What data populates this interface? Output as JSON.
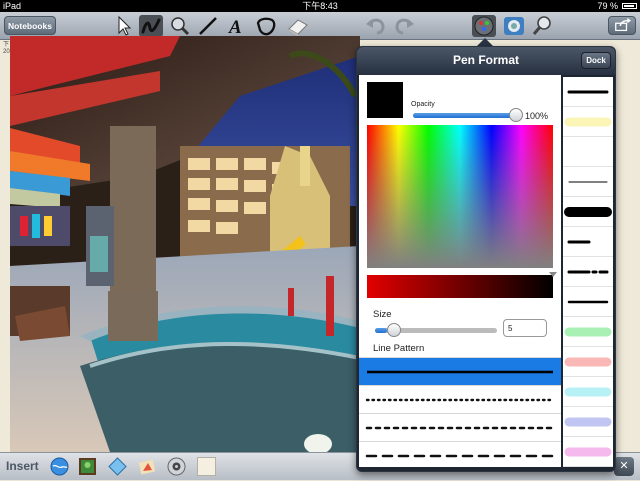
{
  "status": {
    "device": "iPad",
    "time": "下午8:43",
    "battery": "79 %"
  },
  "toolbar": {
    "notebooks_label": "Notebooks",
    "tools": [
      {
        "name": "select-tool-icon"
      },
      {
        "name": "pen-tool-icon"
      },
      {
        "name": "highlighter-tool-icon"
      },
      {
        "name": "line-tool-icon"
      },
      {
        "name": "text-tool-icon"
      },
      {
        "name": "shape-tool-icon"
      },
      {
        "name": "eraser-tool-icon"
      },
      {
        "name": "undo-icon"
      },
      {
        "name": "redo-icon"
      },
      {
        "name": "pen-format-icon"
      },
      {
        "name": "highlighter-format-icon"
      },
      {
        "name": "magnifier-icon"
      }
    ]
  },
  "page": {
    "margin_text": "下\n20"
  },
  "pen_format": {
    "title": "Pen Format",
    "dock_label": "Dock",
    "opacity_label": "Opacity",
    "opacity_value": "100%",
    "opacity_level": 1.0,
    "size_label": "Size",
    "size_value": "5",
    "size_level": 0.1,
    "pattern_label": "Line Pattern",
    "selected_color": "#000000",
    "patterns": [
      {
        "style": "solid",
        "selected": true
      },
      {
        "style": "dotted",
        "selected": false
      },
      {
        "style": "dashed",
        "selected": false
      },
      {
        "style": "long-dashed",
        "selected": false
      }
    ]
  },
  "line_presets": [
    {
      "kind": "thick-black"
    },
    {
      "kind": "yellow-highlight"
    },
    {
      "kind": "blank"
    },
    {
      "kind": "thin-black"
    },
    {
      "kind": "extra-thick-black"
    },
    {
      "kind": "short-black"
    },
    {
      "kind": "dash-dot-black"
    },
    {
      "kind": "medium-black"
    },
    {
      "kind": "green-highlight"
    },
    {
      "kind": "red-highlight"
    },
    {
      "kind": "cyan-highlight"
    },
    {
      "kind": "blue-highlight"
    },
    {
      "kind": "pink-highlight"
    }
  ],
  "bottom": {
    "insert_label": "Insert",
    "icons": [
      "globe-icon",
      "picture-icon",
      "shape-icon",
      "stamp-icon",
      "audio-icon",
      "blank-page-icon"
    ],
    "close_label": "✕"
  },
  "colors": {
    "accent": "#1a7be4",
    "brightness_start": "#e10000"
  }
}
